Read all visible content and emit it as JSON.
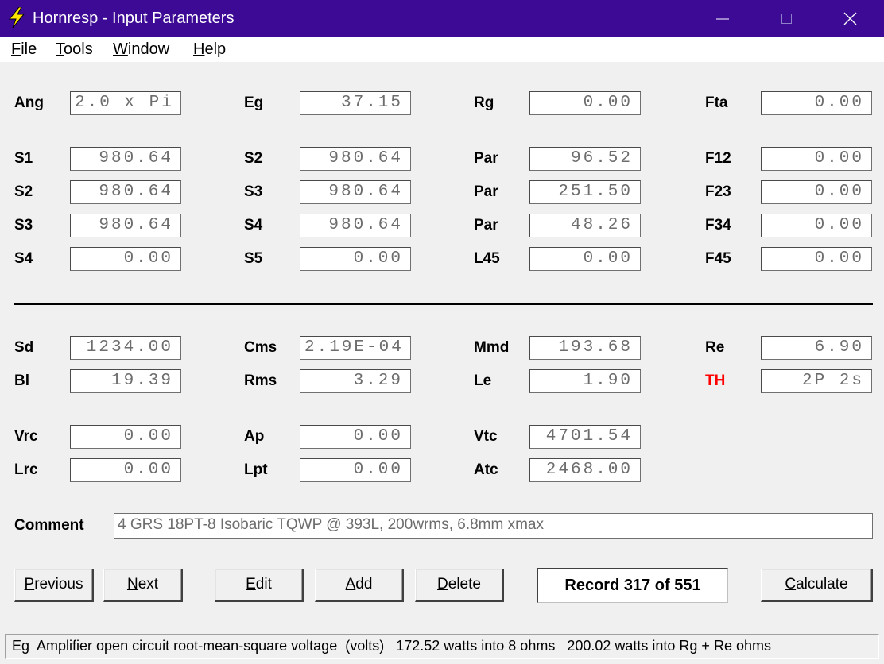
{
  "window": {
    "title": "Hornresp - Input Parameters"
  },
  "menu": [
    "File",
    "Tools",
    "Window",
    "Help"
  ],
  "rows": [
    [
      {
        "label": "Ang",
        "value": "2.0 x Pi"
      },
      {
        "label": "Eg",
        "value": "37.15"
      },
      {
        "label": "Rg",
        "value": "0.00"
      },
      {
        "label": "Fta",
        "value": "0.00"
      }
    ],
    [
      {
        "label": "S1",
        "value": "980.64"
      },
      {
        "label": "S2",
        "value": "980.64"
      },
      {
        "label": "Par",
        "value": "96.52"
      },
      {
        "label": "F12",
        "value": "0.00"
      }
    ],
    [
      {
        "label": "S2",
        "value": "980.64"
      },
      {
        "label": "S3",
        "value": "980.64"
      },
      {
        "label": "Par",
        "value": "251.50"
      },
      {
        "label": "F23",
        "value": "0.00"
      }
    ],
    [
      {
        "label": "S3",
        "value": "980.64"
      },
      {
        "label": "S4",
        "value": "980.64"
      },
      {
        "label": "Par",
        "value": "48.26"
      },
      {
        "label": "F34",
        "value": "0.00"
      }
    ],
    [
      {
        "label": "S4",
        "value": "0.00"
      },
      {
        "label": "S5",
        "value": "0.00"
      },
      {
        "label": "L45",
        "value": "0.00"
      },
      {
        "label": "F45",
        "value": "0.00"
      }
    ],
    [
      {
        "label": "Sd",
        "value": "1234.00"
      },
      {
        "label": "Cms",
        "value": "2.19E-04"
      },
      {
        "label": "Mmd",
        "value": "193.68"
      },
      {
        "label": "Re",
        "value": "6.90"
      }
    ],
    [
      {
        "label": "Bl",
        "value": "19.39"
      },
      {
        "label": "Rms",
        "value": "3.29"
      },
      {
        "label": "Le",
        "value": "1.90"
      },
      {
        "label": "TH",
        "value": "2P 2s"
      }
    ],
    [
      {
        "label": "Vrc",
        "value": "0.00"
      },
      {
        "label": "Ap",
        "value": "0.00"
      },
      {
        "label": "Vtc",
        "value": "4701.54"
      }
    ],
    [
      {
        "label": "Lrc",
        "value": "0.00"
      },
      {
        "label": "Lpt",
        "value": "0.00"
      },
      {
        "label": "Atc",
        "value": "2468.00"
      }
    ]
  ],
  "comment": {
    "label": "Comment",
    "value": "4 GRS 18PT-8 Isobaric TQWP @ 393L, 200wrms, 6.8mm xmax"
  },
  "buttons": [
    "Previous",
    "Next",
    "Edit",
    "Add",
    "Delete",
    "Calculate"
  ],
  "record": "Record 317 of 551",
  "status": "Eg  Amplifier open circuit root-mean-square voltage  (volts)   172.52 watts into 8 ohms   200.02 watts into Rg + Re ohms",
  "colors": {
    "titlebar": "#3c0a94",
    "highlight_label": "#ff0000",
    "field_text": "#6d6d6d"
  }
}
